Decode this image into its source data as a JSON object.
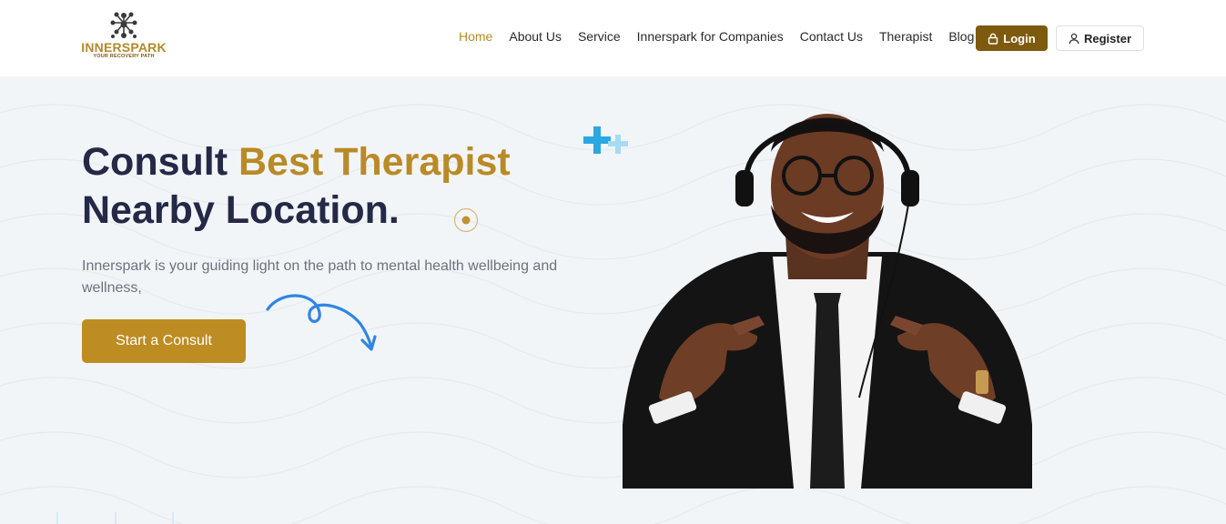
{
  "brand": {
    "name": "INNERSPARK",
    "tagline": "YOUR RECOVERY PATH",
    "accent_color": "#b98a28",
    "dark_accent_color": "#7d5a0e",
    "heading_color": "#232946"
  },
  "nav": {
    "items": [
      {
        "label": "Home",
        "active": true
      },
      {
        "label": "About Us",
        "active": false
      },
      {
        "label": "Service",
        "active": false
      },
      {
        "label": "Innerspark for Companies",
        "active": false
      },
      {
        "label": "Contact Us",
        "active": false
      },
      {
        "label": "Therapist",
        "active": false
      },
      {
        "label": "Blog",
        "active": false
      }
    ],
    "login_label": "Login",
    "login_icon": "lock-icon",
    "register_label": "Register",
    "register_icon": "user-icon"
  },
  "hero": {
    "title_part1": "Consult ",
    "title_accent": "Best Therapist",
    "title_line2": "Nearby Location.",
    "description": "Innerspark is your guiding light on the path to mental health wellbeing and wellness,",
    "cta_label": "Start a Consult",
    "image_icon": "therapist-photo"
  }
}
